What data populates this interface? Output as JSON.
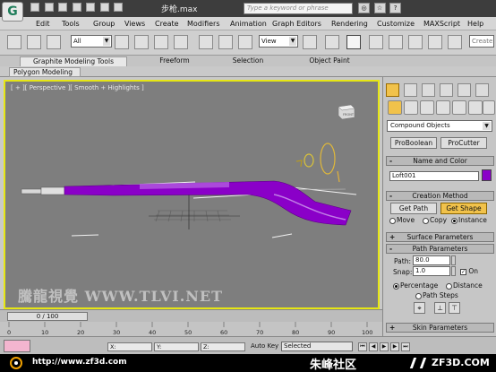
{
  "title_bar": {
    "window_title": "步枪.max",
    "search_placeholder": "Type a keyword or phrase",
    "app_logo": "G"
  },
  "menu": {
    "items": [
      "Edit",
      "Tools",
      "Group",
      "Views",
      "Create",
      "Modifiers",
      "Animation",
      "Graph Editors",
      "Rendering",
      "Customize",
      "MAXScript",
      "Help"
    ]
  },
  "toolbar": {
    "selection_filter": "All",
    "reference_coord": "View",
    "create_selection_set": "Create"
  },
  "ribbon": {
    "tabs": [
      "Graphite Modeling Tools",
      "Freeform",
      "Selection",
      "Object Paint"
    ],
    "sub_tab": "Polygon Modeling"
  },
  "viewport": {
    "label": "[ + ][ Perspective ][ Smooth + Highlights ]",
    "viewcube_label": "FRONT",
    "watermark": "騰龍視覺 WWW.TLVI.NET"
  },
  "command_panel": {
    "category": "Compound Objects",
    "buttons": [
      "ProBoolean",
      "ProCutter"
    ],
    "name_and_color": {
      "title": "Name and Color",
      "object_name": "Loft001",
      "swatch_color": "#8a00c8"
    },
    "creation_method": {
      "title": "Creation Method",
      "get_path": "Get Path",
      "get_shape": "Get Shape",
      "options": [
        "Move",
        "Copy",
        "Instance"
      ],
      "selected_option": "Instance"
    },
    "surface_parameters": {
      "title": "Surface Parameters"
    },
    "path_parameters": {
      "title": "Path Parameters",
      "path_label": "Path:",
      "path_value": "80.0",
      "snap_label": "Snap:",
      "snap_value": "1.0",
      "on_label": "On",
      "on_checked": true,
      "percentage": "Percentage",
      "distance": "Distance",
      "path_steps": "Path Steps"
    },
    "skin_parameters": {
      "title": "Skin Parameters"
    }
  },
  "timeline": {
    "slider": "0 / 100",
    "ticks": [
      "0",
      "10",
      "20",
      "30",
      "40",
      "50",
      "60",
      "70",
      "80",
      "90",
      "100"
    ]
  },
  "statusbar": {
    "x_label": "X:",
    "y_label": "Y:",
    "z_label": "Z:",
    "auto_key": "Auto Key",
    "selected": "Selected"
  },
  "footer": {
    "url": "http://www.zf3d.com",
    "chinese_site": "朱峰社区",
    "domain": "ZF3D.COM"
  },
  "colors": {
    "viewport_bg": "#7e7e7e",
    "active_border": "#e6e614",
    "rifle": "#8a00c8",
    "create_tab": "#f1c24b",
    "get_shape_active": "#f1c24b"
  }
}
